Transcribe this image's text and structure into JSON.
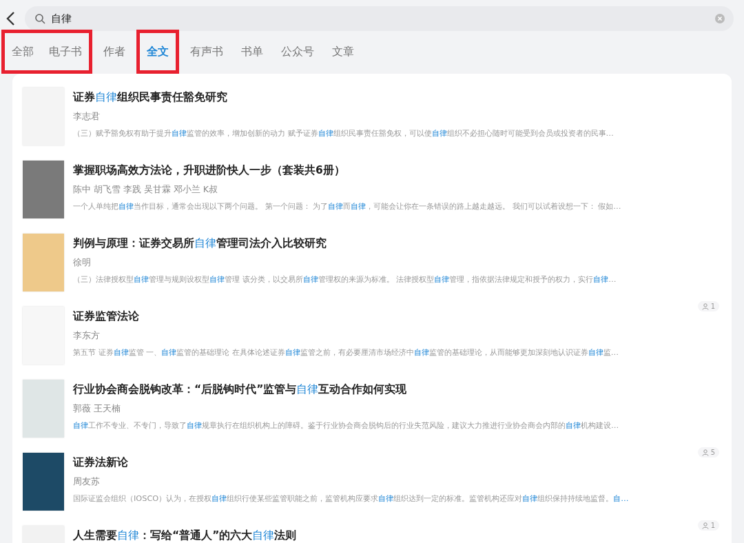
{
  "search": {
    "value": "自律"
  },
  "tab_groups": [
    {
      "annotated": true,
      "tabs": [
        {
          "label": "全部",
          "selected": false
        },
        {
          "label": "电子书",
          "selected": false
        }
      ]
    },
    {
      "annotated": false,
      "tabs": [
        {
          "label": "作者",
          "selected": false
        }
      ]
    },
    {
      "annotated": true,
      "tabs": [
        {
          "label": "全文",
          "selected": true
        }
      ]
    },
    {
      "annotated": false,
      "tabs": [
        {
          "label": "有声书",
          "selected": false
        },
        {
          "label": "书单",
          "selected": false
        },
        {
          "label": "公众号",
          "selected": false
        },
        {
          "label": "文章",
          "selected": false
        }
      ]
    }
  ],
  "results": [
    {
      "color": "#f4f4f4",
      "title": "证券**自律**组织民事责任豁免研究",
      "author": "李志君",
      "excerpt": "（三）赋予豁免权有助于提升**自律**监管的效率，增加创新的动力 赋予证券**自律**组织民事责任豁免权，可以使**自律**组织不必担心随时可能受到会员或投资者的民事…"
    },
    {
      "color": "#7a7a7a",
      "title": "掌握职场高效方法论，升职进阶快人一步（套装共6册）",
      "author": "陈中 胡飞雪 李践 吴甘霖 邓小兰 K叔",
      "excerpt": "一个人单纯把**自律**当作目标，通常会出现以下两个问题。 第一个问题： 为了**自律**而**自律**，可能会让你在一条错误的路上越走越远。 我们可以试着设想一下： 假如…"
    },
    {
      "color": "#eec98a",
      "title": "判例与原理：证券交易所**自律**管理司法介入比较研究",
      "author": "徐明",
      "excerpt": "（三）法律授权型**自律**管理与规则设权型**自律**管理 该分类，以交易所**自律**管理权的来源为标准。 法律授权型**自律**管理，指依据法律规定和授予的权力，实行**自律**…"
    },
    {
      "color": "#f7f7f7",
      "title": "证券监管法论",
      "author": "李东方",
      "excerpt": "第五节 证券**自律**监管 一、**自律**监管的基础理论 在具体论述证券**自律**监管之前，有必要厘清市场经济中**自律**监管的基础理论，从而能够更加深刻地认识证券**自律**监…",
      "readers": "1"
    },
    {
      "color": "#dfe6e6",
      "title": "行业协会商会脱钩改革：“后脱钩时代”监管与**自律**互动合作如何实现",
      "author": "郭薇 王天楠",
      "excerpt": "**自律**工作不专业、不专门，导致了**自律**规章执行在组织机构上的障碍。鉴于行业协会商会脱钩后的行业失范风险，建议大力推进行业协会商会内部的**自律**机构建设…"
    },
    {
      "color": "#1d4a66",
      "title": "证券法新论",
      "author": "周友苏",
      "excerpt": "国际证监会组织（IOSCO）认为，在授权**自律**组织行使某些监管职能之前，监管机构应要求**自律**组织达到一定的标准。监管机构还应对**自律**组织保持持续地监督。**自…**",
      "readers": "5"
    },
    {
      "color": "#f2f2f2",
      "title": "人生需要**自律**：写给“普通人”的六大**自律**法则",
      "readers": "1"
    }
  ]
}
